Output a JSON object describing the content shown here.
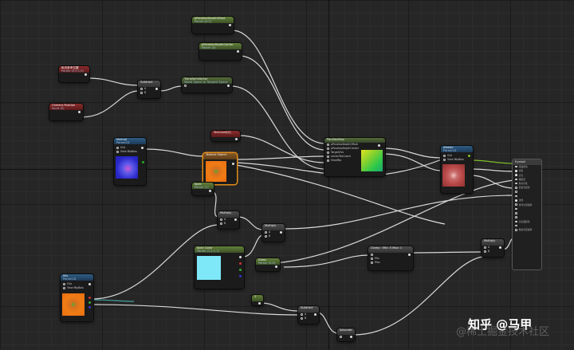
{
  "nodes": {
    "pixelDepthOffset": {
      "title": "pParallaxDepthOffset",
      "subtitle": "Param (0.5)"
    },
    "pixelDepthCenter": {
      "title": "pParallaxDepthCenter",
      "subtitle": "Param (0)"
    },
    "vecParamA": {
      "title": "纵向参考位置",
      "subtitle": "Param (0,0,1,0)"
    },
    "cameraPos": {
      "title": "Camera Position",
      "subtitle": "Input (0)"
    },
    "subtract1": {
      "title": "Subtract",
      "a": "A",
      "b": "B"
    },
    "transformVec": {
      "title": "TransformVector",
      "subtitle": "World Space to Tangent Space"
    },
    "texCoord": {
      "title": "TexCoord[0]"
    },
    "normalTex": {
      "title": "Normal",
      "subtitle": "Param2D",
      "rows": [
        "UVs",
        "View MipBias"
      ]
    },
    "textureObject": {
      "title": "Texture Object"
    },
    "parallaxMap": {
      "title": "ParallaxMap",
      "rows": [
        "pParallaxDepthOffset",
        "pParallaxDepthCenter",
        "TargetUVs",
        "vectorTexCoord",
        "ViewMip"
      ]
    },
    "albedo": {
      "title": "Albedo",
      "subtitle": "Param2D",
      "rows": [
        "UVs",
        "View MipBias"
      ]
    },
    "spec": {
      "title": "Spec",
      "subtitle": "Param (1)"
    },
    "multiply1": {
      "title": "Multiply",
      "a": "A",
      "b": "B"
    },
    "multiply2": {
      "title": "Multiply",
      "a": "A",
      "b": "B"
    },
    "specColor": {
      "title": "Spec Color",
      "subtitle": "Param (1,1,1,1)"
    },
    "gloss": {
      "title": "Gloss",
      "subtitle": "Param (0.5)"
    },
    "clamp": {
      "title": "Clamp : Min: 0  Max: 1",
      "rows": [
        "Min",
        "Max"
      ]
    },
    "multiply3": {
      "title": "Multiply",
      "a": "A",
      "b": "B"
    },
    "mix": {
      "title": "Mix",
      "subtitle": "Param2D",
      "rows": [
        "UVs",
        "View MipBias"
      ]
    },
    "one": {
      "title": "1"
    },
    "subtract2": {
      "title": "Subtract",
      "a": "A",
      "b": "B"
    },
    "saturate": {
      "title": "Saturate"
    }
  },
  "result": {
    "title": "Eyeball",
    "rows": [
      "基础颜色",
      "金属",
      "高光",
      "粗糙度",
      "各向异性",
      "自发光颜色",
      "",
      "",
      "法线",
      "世界位置偏移",
      "",
      "",
      "",
      "次表面颜色",
      "",
      "像素深度偏移"
    ]
  },
  "watermark": {
    "main": "知乎 @马甲",
    "sub": "@稀土掘金技术社区"
  }
}
